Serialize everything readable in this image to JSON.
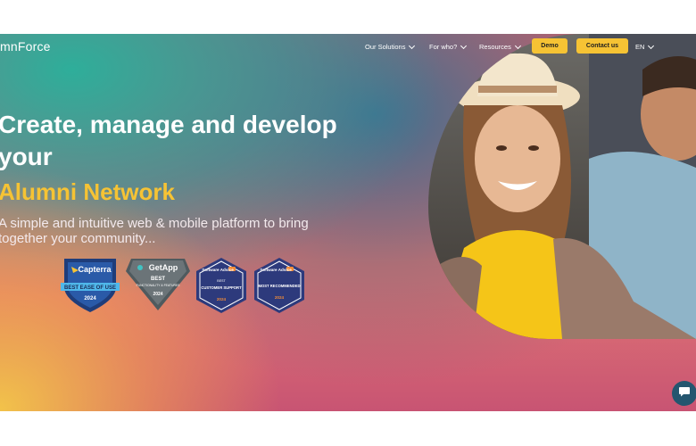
{
  "header": {
    "logo": "mnForce",
    "nav": [
      {
        "label": "Our Solutions"
      },
      {
        "label": "For who?"
      },
      {
        "label": "Resources"
      }
    ],
    "demo_button": "Demo",
    "contact_button": "Contact us",
    "language": "EN"
  },
  "hero": {
    "headline": "Create, manage and develop your",
    "headline_highlight": "Alumni Network",
    "subtitle": "A simple and intuitive web & mobile platform to bring together your community..."
  },
  "badges": [
    {
      "brand": "Capterra",
      "title": "BEST EASE OF USE",
      "year": "2024"
    },
    {
      "brand": "GetApp",
      "title": "BEST",
      "detail": "FUNCTIONALITY & FEATURES",
      "year": "2024"
    },
    {
      "brand": "Software Advice",
      "detail": "BEST",
      "title": "CUSTOMER SUPPORT",
      "year": "2024"
    },
    {
      "brand": "Software Advice",
      "title": "MOST RECOMMENDED",
      "year": "2024"
    }
  ],
  "colors": {
    "accent": "#f6c334",
    "teal": "#2eae9a",
    "pink": "#d7636e",
    "badge_navy": "#2d3a7c"
  },
  "icons": {
    "chat": "chat-bubble-icon",
    "chevron": "chevron-down-icon"
  }
}
